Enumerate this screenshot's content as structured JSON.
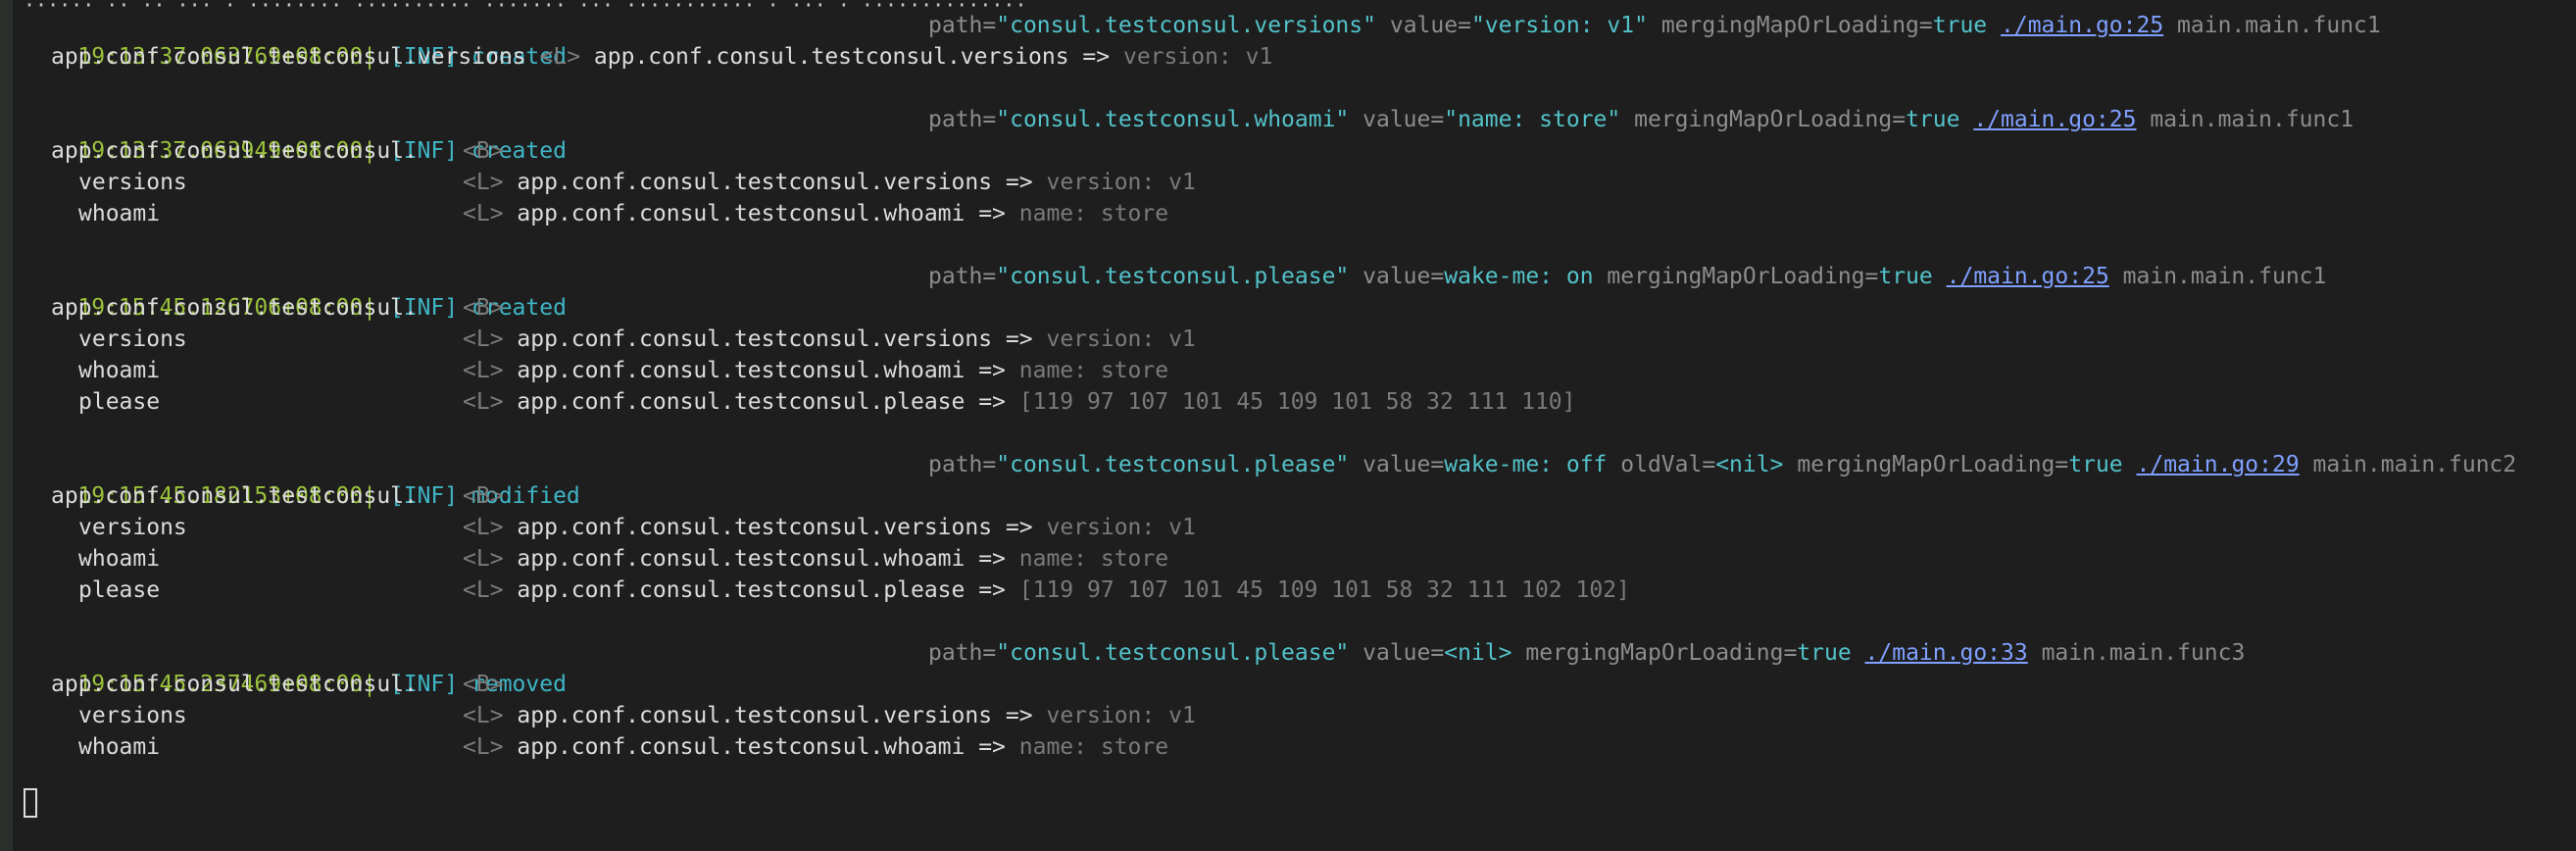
{
  "top_partial": "······ ·· ·· ··· · ········ ·········· ······· ··· ··········· · ··· · ··············",
  "entries": [
    {
      "ts": "19:13:37.063769+08:00|",
      "level": "[INF]",
      "msg": "created",
      "path": "\"consul.testconsul.versions\"",
      "value": "\"version: v1\"",
      "merge": "true",
      "link": "./main.go:25",
      "func": "main.main.func1",
      "line1": "app.conf.consul.testconsul.versions",
      "line1_tag": "<L>",
      "line1_path": "app.conf.consul.testconsul.versions =>",
      "line1_val": "version: v1"
    },
    {
      "ts": "19:13:37.063949+08:00|",
      "level": "[INF]",
      "msg": "created",
      "path": "\"consul.testconsul.whoami\"",
      "value": "\"name: store\"",
      "merge": "true",
      "link": "./main.go:25",
      "func": "main.main.func1",
      "root": "app.conf.consul.testconsul.",
      "root_tag": "<B>",
      "rows": [
        {
          "key": "versions",
          "tag": "<L>",
          "path": "app.conf.consul.testconsul.versions =>",
          "val": "version: v1"
        },
        {
          "key": "whoami",
          "tag": "<L>",
          "path": "app.conf.consul.testconsul.whoami =>",
          "val": "name: store"
        }
      ]
    },
    {
      "ts": "19:15:45.126706+08:00|",
      "level": "[INF]",
      "msg": "created",
      "path": "\"consul.testconsul.please\"",
      "value": "wake-me: on",
      "merge": "true",
      "link": "./main.go:25",
      "func": "main.main.func1",
      "root": "app.conf.consul.testconsul.",
      "root_tag": "<B>",
      "rows": [
        {
          "key": "versions",
          "tag": "<L>",
          "path": "app.conf.consul.testconsul.versions =>",
          "val": "version: v1"
        },
        {
          "key": "whoami",
          "tag": "<L>",
          "path": "app.conf.consul.testconsul.whoami =>",
          "val": "name: store"
        },
        {
          "key": "please",
          "tag": "<L>",
          "path": "app.conf.consul.testconsul.please =>",
          "val": "[119 97 107 101 45 109 101 58 32 111 110]"
        }
      ]
    },
    {
      "ts": "19:15:45.182153+08:00|",
      "level": "[INF]",
      "msg": "modified",
      "path": "\"consul.testconsul.please\"",
      "value": "wake-me: off",
      "oldval": "<nil>",
      "merge": "true",
      "link": "./main.go:29",
      "func": "main.main.func2",
      "root": "app.conf.consul.testconsul.",
      "root_tag": "<B>",
      "rows": [
        {
          "key": "versions",
          "tag": "<L>",
          "path": "app.conf.consul.testconsul.versions =>",
          "val": "version: v1"
        },
        {
          "key": "whoami",
          "tag": "<L>",
          "path": "app.conf.consul.testconsul.whoami =>",
          "val": "name: store"
        },
        {
          "key": "please",
          "tag": "<L>",
          "path": "app.conf.consul.testconsul.please =>",
          "val": "[119 97 107 101 45 109 101 58 32 111 102 102]"
        }
      ]
    },
    {
      "ts": "19:15:45.237469+08:00|",
      "level": "[INF]",
      "msg": "removed",
      "path": "\"consul.testconsul.please\"",
      "value": "<nil>",
      "merge": "true",
      "link": "./main.go:33",
      "func": "main.main.func3",
      "root": "app.conf.consul.testconsul.",
      "root_tag": "<B>",
      "rows": [
        {
          "key": "versions",
          "tag": "<L>",
          "path": "app.conf.consul.testconsul.versions =>",
          "val": "version: v1"
        },
        {
          "key": "whoami",
          "tag": "<L>",
          "path": "app.conf.consul.testconsul.whoami =>",
          "val": "name: store"
        }
      ]
    }
  ],
  "labels": {
    "path_key": "path=",
    "value_key": "value=",
    "oldval_key": "oldVal=",
    "merge_key": "mergingMapOrLoading="
  }
}
